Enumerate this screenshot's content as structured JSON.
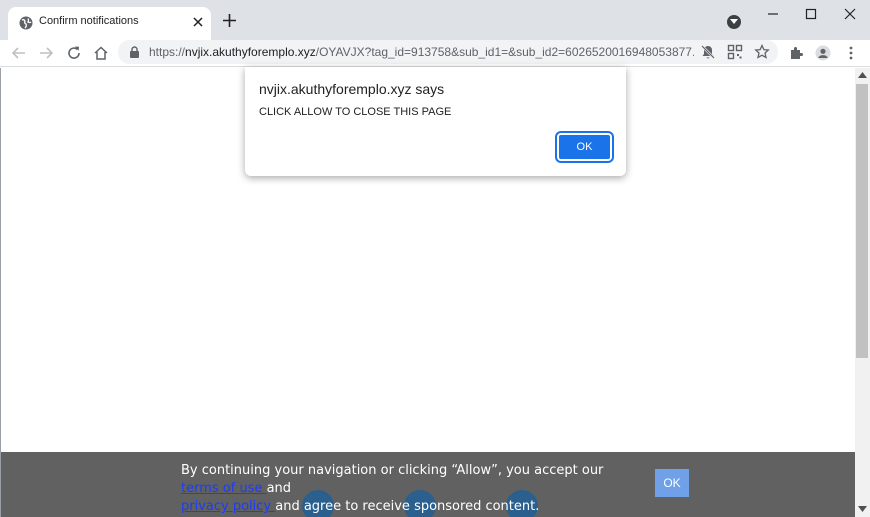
{
  "browser": {
    "tab": {
      "title": "Confirm notifications",
      "favicon": "globe-icon"
    },
    "address": {
      "prefix": "https://",
      "host": "nvjix.akuthyforemplo.xyz",
      "path": "/OYAVJX?tag_id=913758&sub_id1=&sub_id2=6026520016948053877..."
    }
  },
  "alert": {
    "title": "nvjix.akuthyforemplo.xyz says",
    "message": "CLICK ALLOW TO CLOSE THIS PAGE",
    "ok_label": "OK"
  },
  "banner": {
    "text_start": "By continuing your navigation or clicking “Allow”, you accept our ",
    "terms_link": "terms of use ",
    "text_and": "and",
    "privacy_link": "privacy policy ",
    "text_end": "and agree to receive sponsored content.",
    "ok_label": "OK"
  },
  "colors": {
    "accent": "#1a73e8",
    "banner_bg": "#616161",
    "link": "#1a3cff"
  }
}
